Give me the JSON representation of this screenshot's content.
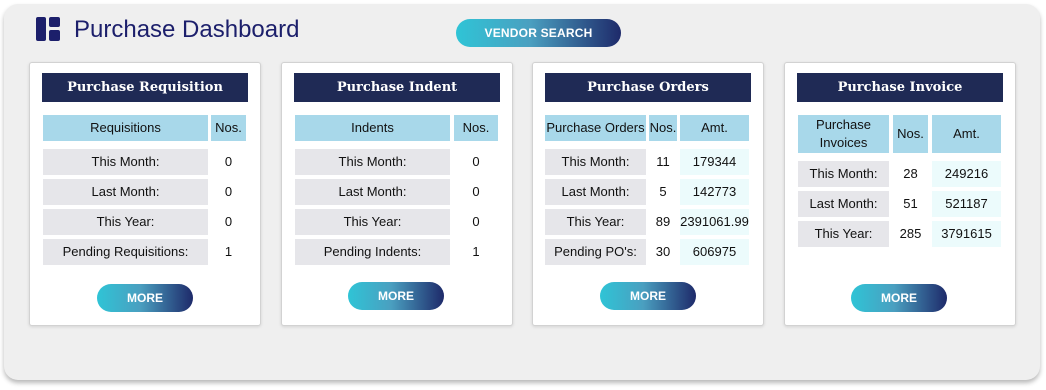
{
  "header": {
    "title": "Purchase Dashboard",
    "vendor_search_label": "VENDOR SEARCH"
  },
  "colors": {
    "card_header": "#1f2a55",
    "column_header": "#a8d8ea",
    "label_bg": "#e6e6ea",
    "title_text": "#1c1f6b"
  },
  "cards": [
    {
      "title": "Purchase Requisition",
      "columns": [
        "Requisitions",
        "Nos."
      ],
      "rows": [
        {
          "label": "This Month:",
          "nos": "0"
        },
        {
          "label": "Last Month:",
          "nos": "0"
        },
        {
          "label": "This Year:",
          "nos": "0"
        },
        {
          "label": "Pending Requisitions:",
          "nos": "1"
        }
      ],
      "more_label": "MORE"
    },
    {
      "title": "Purchase Indent",
      "columns": [
        "Indents",
        "Nos."
      ],
      "rows": [
        {
          "label": "This Month:",
          "nos": "0"
        },
        {
          "label": "Last Month:",
          "nos": "0"
        },
        {
          "label": "This Year:",
          "nos": "0"
        },
        {
          "label": "Pending Indents:",
          "nos": "1"
        }
      ],
      "more_label": "MORE"
    },
    {
      "title": "Purchase Orders",
      "columns": [
        "Purchase Orders",
        "Nos.",
        "Amt."
      ],
      "rows": [
        {
          "label": "This Month:",
          "nos": "11",
          "amt": "179344"
        },
        {
          "label": "Last Month:",
          "nos": "5",
          "amt": "142773"
        },
        {
          "label": "This Year:",
          "nos": "89",
          "amt": "2391061.99"
        },
        {
          "label": "Pending PO's:",
          "nos": "30",
          "amt": "606975"
        }
      ],
      "more_label": "MORE"
    },
    {
      "title": "Purchase Invoice",
      "columns": [
        "Purchase Invoices",
        "Nos.",
        "Amt."
      ],
      "rows": [
        {
          "label": "This Month:",
          "nos": "28",
          "amt": "249216"
        },
        {
          "label": "Last Month:",
          "nos": "51",
          "amt": "521187"
        },
        {
          "label": "This Year:",
          "nos": "285",
          "amt": "3791615"
        }
      ],
      "more_label": "MORE"
    }
  ]
}
